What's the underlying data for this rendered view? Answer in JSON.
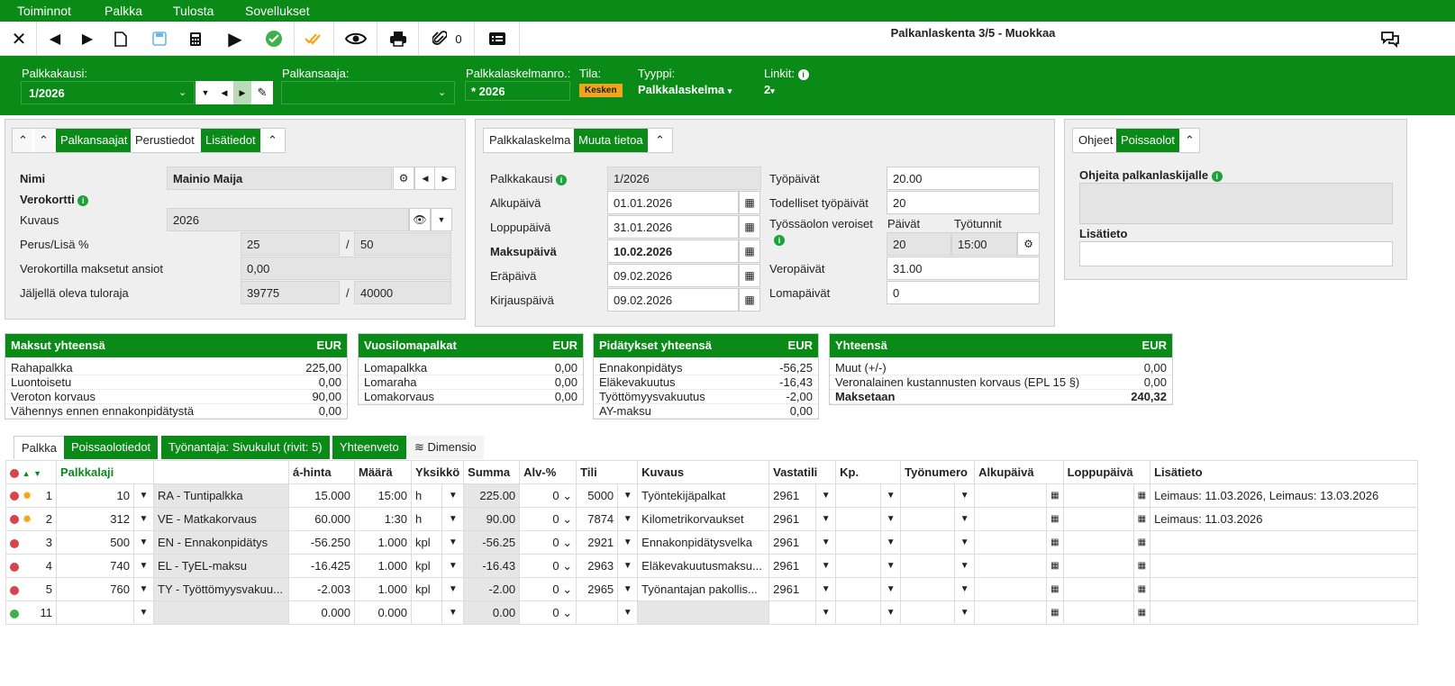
{
  "menu": {
    "items": [
      "Toiminnot",
      "Palkka",
      "Tulosta",
      "Sovellukset"
    ]
  },
  "toolbar": {
    "attachments_count": "0",
    "title": "Palkanlaskenta 3/5 - Muokkaa"
  },
  "header": {
    "period_label": "Palkkakausi:",
    "period_value": "1/2026",
    "payee_label": "Palkansaaja:",
    "payee_value": "",
    "calcno_label": "Palkkalaskelmanro.:",
    "calcno_value": "* 2026",
    "status_label": "Tila:",
    "status_value": "Kesken",
    "type_label": "Tyyppi:",
    "type_value": "Palkkalaskelma",
    "links_label": "Linkit:",
    "links_value": "2"
  },
  "left_panel": {
    "tabs": [
      "Palkansaajat",
      "Perustiedot",
      "Lisätiedot"
    ],
    "name_label": "Nimi",
    "name_value": "Mainio Maija",
    "taxcard_label": "Verokortti",
    "desc_label": "Kuvaus",
    "desc_value": "2026",
    "rate_label": "Perus/Lisä %",
    "rate_base": "25",
    "rate_extra": "50",
    "slash": "/",
    "paid_label": "Verokortilla maksetut ansiot",
    "paid_value": "0,00",
    "limit_label": "Jäljellä oleva tuloraja",
    "limit_value": "39775",
    "limit_total": "40000"
  },
  "mid_panel": {
    "tabs": [
      "Palkkalaskelma",
      "Muuta tietoa"
    ],
    "period_label": "Palkkakausi",
    "period_value": "1/2026",
    "start_label": "Alkupäivä",
    "start_value": "01.01.2026",
    "end_label": "Loppupäivä",
    "end_value": "31.01.2026",
    "paydate_label": "Maksupäivä",
    "paydate_value": "10.02.2026",
    "due_label": "Eräpäivä",
    "due_value": "09.02.2026",
    "book_label": "Kirjauspäivä",
    "book_value": "09.02.2026",
    "workdays_label": "Työpäivät",
    "workdays_value": "20.00",
    "actual_label": "Todelliset työpäivät",
    "actual_value": "20",
    "benefit_label": "Työssäolon veroiset",
    "days_label": "Päivät",
    "hours_label": "Työtunnit",
    "days_value": "20",
    "hours_value": "15:00",
    "taxdays_label": "Veropäivät",
    "taxdays_value": "31.00",
    "holiday_label": "Lomapäivät",
    "holiday_value": "0"
  },
  "right_panel": {
    "tabs": [
      "Ohjeet",
      "Poissaolot"
    ],
    "instr_label": "Ohjeita palkanlaskijalle",
    "extra_label": "Lisätieto"
  },
  "summaries": [
    {
      "title": "Maksut yhteensä",
      "cur": "EUR",
      "rows": [
        [
          "Rahapalkka",
          "225,00"
        ],
        [
          "Luontoisetu",
          "0,00"
        ],
        [
          "Veroton korvaus",
          "90,00"
        ],
        [
          "Vähennys ennen ennakonpidätystä",
          "0,00"
        ]
      ]
    },
    {
      "title": "Vuosilomapalkat",
      "cur": "EUR",
      "rows": [
        [
          "Lomapalkka",
          "0,00"
        ],
        [
          "Lomaraha",
          "0,00"
        ],
        [
          "Lomakorvaus",
          "0,00"
        ]
      ]
    },
    {
      "title": "Pidätykset yhteensä",
      "cur": "EUR",
      "rows": [
        [
          "Ennakonpidätys",
          "-56,25"
        ],
        [
          "Eläkevakuutus",
          "-16,43"
        ],
        [
          "Työttömyysvakuutus",
          "-2,00"
        ],
        [
          "AY-maksu",
          "0,00"
        ]
      ]
    },
    {
      "title": "Yhteensä",
      "cur": "EUR",
      "rows": [
        [
          "Muut (+/-)",
          "0,00"
        ],
        [
          "Veronalainen kustannusten korvaus (EPL 15 §)",
          "0,00"
        ],
        [
          "Maksetaan",
          "240,32"
        ]
      ]
    }
  ],
  "bottom_tabs": [
    "Palkka",
    "Poissaolotiedot",
    "Työnantaja: Sivukulut (rivit: 5)",
    "Yhteenveto",
    "Dimensio"
  ],
  "grid": {
    "headers": [
      "Palkkalaji",
      "á-hinta",
      "Määrä",
      "Yksikkö",
      "Summa",
      "Alv-%",
      "Tili",
      "Kuvaus",
      "Vastatili",
      "Kp.",
      "Työnumero",
      "Alkupäivä",
      "Loppupäivä",
      "Lisätieto"
    ],
    "rows": [
      {
        "n": "1",
        "code": "10",
        "name": "RA - Tuntipalkka",
        "price": "15.000",
        "qty": "15:00",
        "unit": "h",
        "sum": "225.00",
        "vat": "0",
        "acc": "5000",
        "desc": "Työntekijäpalkat",
        "contra": "2961",
        "info": "Leimaus: 11.03.2026, Leimaus: 13.03.2026"
      },
      {
        "n": "2",
        "code": "312",
        "name": "VE - Matkakorvaus",
        "price": "60.000",
        "qty": "1:30",
        "unit": "h",
        "sum": "90.00",
        "vat": "0",
        "acc": "7874",
        "desc": "Kilometrikorvaukset",
        "contra": "2961",
        "info": "Leimaus: 11.03.2026"
      },
      {
        "n": "3",
        "code": "500",
        "name": "EN - Ennakonpidätys",
        "price": "-56.250",
        "qty": "1.000",
        "unit": "kpl",
        "sum": "-56.25",
        "vat": "0",
        "acc": "2921",
        "desc": "Ennakonpidätysvelka",
        "contra": "2961",
        "info": ""
      },
      {
        "n": "4",
        "code": "740",
        "name": "EL - TyEL-maksu",
        "price": "-16.425",
        "qty": "1.000",
        "unit": "kpl",
        "sum": "-16.43",
        "vat": "0",
        "acc": "2963",
        "desc": "Eläkevakuutusmaksu...",
        "contra": "2961",
        "info": ""
      },
      {
        "n": "5",
        "code": "760",
        "name": "TY - Työttömyysvakuu...",
        "price": "-2.003",
        "qty": "1.000",
        "unit": "kpl",
        "sum": "-2.00",
        "vat": "0",
        "acc": "2965",
        "desc": "Työnantajan pakollis...",
        "contra": "2961",
        "info": ""
      },
      {
        "n": "11",
        "code": "",
        "name": "",
        "price": "0.000",
        "qty": "0.000",
        "unit": "",
        "sum": "0.00",
        "vat": "0",
        "acc": "",
        "desc": "",
        "contra": "",
        "info": ""
      }
    ]
  }
}
